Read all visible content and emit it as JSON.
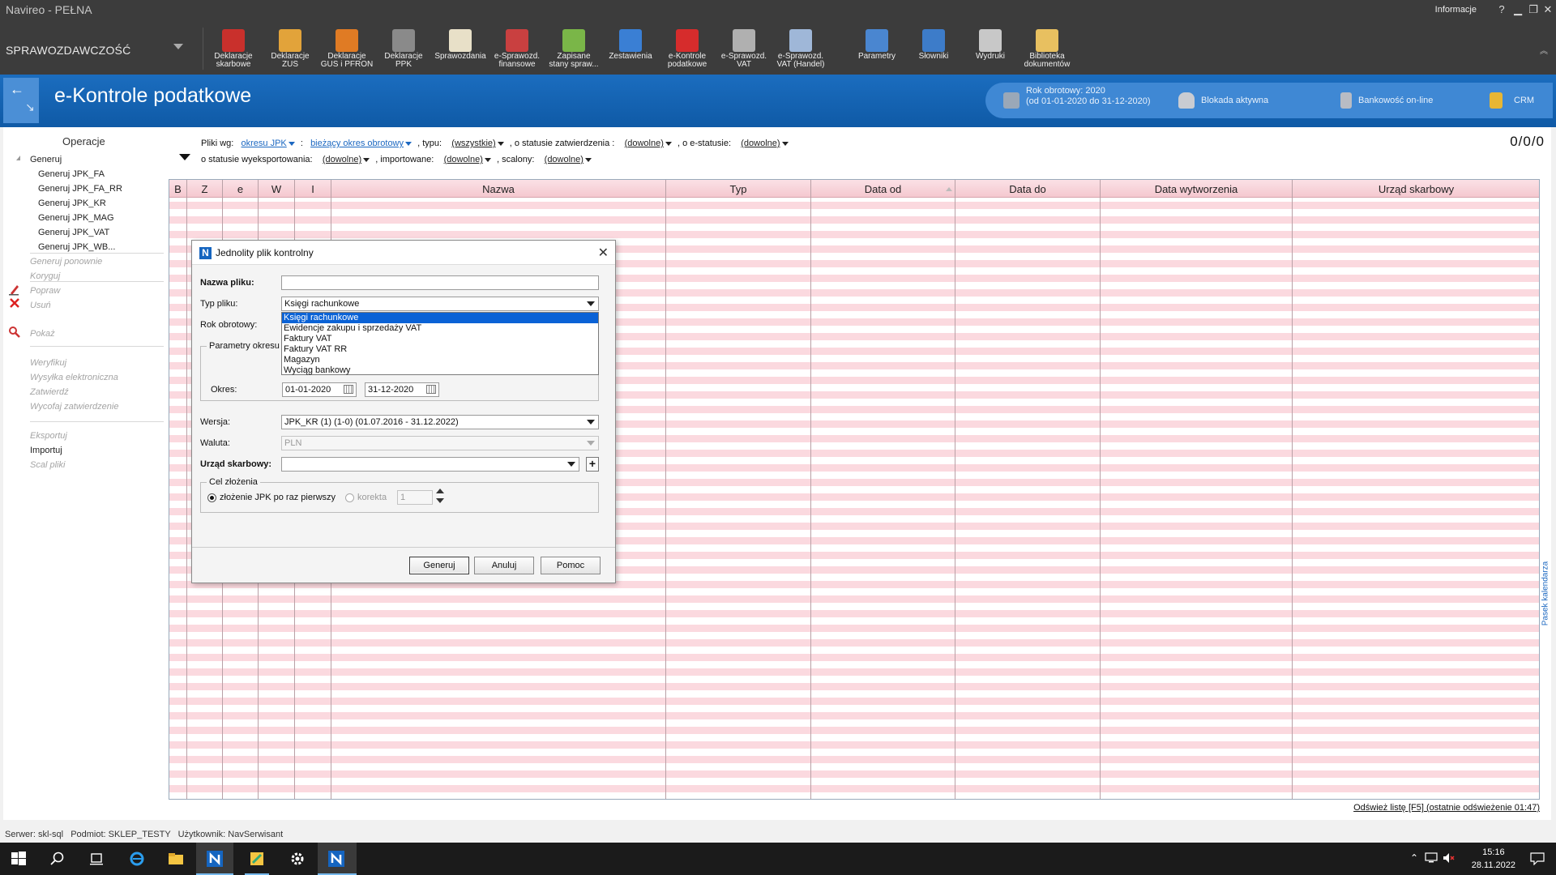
{
  "window": {
    "title": "Navireo - PEŁNA",
    "info_label": "Informacje",
    "help": "?",
    "minimize": "▁",
    "restore": "❐",
    "close": "✕"
  },
  "ribbon": {
    "module": "SPRAWOZDAWCZOŚĆ",
    "collapse": "︽",
    "tools": [
      {
        "line1": "Deklaracje",
        "line2": "skarbowe",
        "icon": "tax-declaration-icon",
        "color": "#c9302c"
      },
      {
        "line1": "Deklaracje",
        "line2": "ZUS",
        "icon": "zus-declaration-icon",
        "color": "#e2a33a"
      },
      {
        "line1": "Deklaracje",
        "line2": "GUS i PFRON",
        "icon": "gus-declaration-icon",
        "color": "#e07b24"
      },
      {
        "line1": "Deklaracje",
        "line2": "PPK",
        "icon": "ppk-declaration-icon",
        "color": "#8a8a8a"
      },
      {
        "line1": "Sprawozdania",
        "line2": "",
        "icon": "reports-icon",
        "color": "#e8e0c8"
      },
      {
        "line1": "e-Sprawozd.",
        "line2": "finansowe",
        "icon": "e-financial-report-icon",
        "color": "#c94040"
      },
      {
        "line1": "Zapisane",
        "line2": "stany spraw...",
        "icon": "saved-states-icon",
        "color": "#7ab648"
      },
      {
        "line1": "Zestawienia",
        "line2": "",
        "icon": "statements-chart-icon",
        "color": "#3a7fd4"
      },
      {
        "line1": "e-Kontrole",
        "line2": "podatkowe",
        "icon": "e-tax-control-icon",
        "color": "#d62c2c"
      },
      {
        "line1": "e-Sprawozd.",
        "line2": "VAT",
        "icon": "e-vat-report-icon",
        "color": "#b0b0b0"
      },
      {
        "line1": "e-Sprawozd.",
        "line2": "VAT (Handel)",
        "icon": "e-vat-trade-report-icon",
        "color": "#9fb7d8"
      },
      {
        "line1": "Parametry",
        "line2": "",
        "icon": "parameters-icon",
        "color": "#4a86d0"
      },
      {
        "line1": "Słowniki",
        "line2": "",
        "icon": "dictionaries-icon",
        "color": "#3d7cc9"
      },
      {
        "line1": "Wydruki",
        "line2": "",
        "icon": "printouts-icon",
        "color": "#c8c8c8"
      },
      {
        "line1": "Biblioteka",
        "line2": "dokumentów",
        "icon": "document-library-icon",
        "color": "#e8c060"
      }
    ]
  },
  "header": {
    "title": "e-Kontrole podatkowe",
    "year_line1": "Rok obrotowy: 2020",
    "year_line2": "(od 01-01-2020 do 31-12-2020)",
    "lock": "Blokada aktywna",
    "bank": "Bankowość on-line",
    "crm": "CRM"
  },
  "operations": {
    "title": "Operacje",
    "items": [
      {
        "label": "Generuj",
        "state": "act",
        "sub": false
      },
      {
        "label": "Generuj JPK_FA",
        "state": "act",
        "sub": true
      },
      {
        "label": "Generuj JPK_FA_RR",
        "state": "act",
        "sub": true
      },
      {
        "label": "Generuj JPK_KR",
        "state": "act",
        "sub": true
      },
      {
        "label": "Generuj JPK_MAG",
        "state": "act",
        "sub": true
      },
      {
        "label": "Generuj JPK_VAT",
        "state": "act",
        "sub": true
      },
      {
        "label": "Generuj JPK_WB...",
        "state": "act",
        "sub": true
      },
      {
        "label": "Generuj ponownie",
        "state": "dis",
        "sub": false
      },
      {
        "label": "Koryguj",
        "state": "dis",
        "sub": false
      },
      {
        "label": "Popraw",
        "state": "dis",
        "sub": false
      },
      {
        "label": "Usuń",
        "state": "dis",
        "sub": false
      },
      {
        "label": "Pokaż",
        "state": "dis",
        "sub": false
      },
      {
        "label": "Weryfikuj",
        "state": "dis",
        "sub": false
      },
      {
        "label": "Wysyłka elektroniczna",
        "state": "dis",
        "sub": false
      },
      {
        "label": "Zatwierdź",
        "state": "dis",
        "sub": false
      },
      {
        "label": "Wycofaj zatwierdzenie",
        "state": "dis",
        "sub": false
      },
      {
        "label": "Eksportuj",
        "state": "dis",
        "sub": false
      },
      {
        "label": "Importuj",
        "state": "act",
        "sub": false
      },
      {
        "label": "Scal pliki",
        "state": "dis",
        "sub": false
      }
    ]
  },
  "filters": {
    "row1": {
      "prefix": "Pliki wg:",
      "by": "okresu JPK",
      "colon": ":",
      "period": "bieżący okres obrotowy",
      "type_label": ", typu:",
      "type": "(wszystkie)",
      "approval_label": ", o statusie zatwierdzenia :",
      "approval": "(dowolne)",
      "estatus_label": ", o e-statusie:",
      "estatus": "(dowolne)"
    },
    "row2": {
      "export_label": "o statusie wyeksportowania:",
      "export": "(dowolne)",
      "imported_label": ", importowane:",
      "imported": "(dowolne)",
      "merged_label": ", scalony:",
      "merged": "(dowolne)"
    },
    "counter": "0/0/0"
  },
  "grid": {
    "columns": [
      "B",
      "Z",
      "e",
      "W",
      "I",
      "Nazwa",
      "Typ",
      "Data od",
      "Data do",
      "Data wytworzenia",
      "Urząd skarbowy"
    ]
  },
  "refresh_link": "Odśwież listę [F5] (ostatnie odświeżenie 01:47)",
  "calendar_strip": "Pasek kalendarza",
  "dialog": {
    "title": "Jednolity plik kontrolny",
    "logo": "N",
    "file_name_label": "Nazwa pliku:",
    "file_name_value": "",
    "file_type_label": "Typ pliku:",
    "file_type_value": "Księgi rachunkowe",
    "fiscal_year_label": "Rok obrotowy:",
    "period_group_label": "Parametry okresu",
    "file_type_options": [
      "Księgi rachunkowe",
      "Ewidencje zakupu i sprzedaży VAT",
      "Faktury VAT",
      "Faktury VAT RR",
      "Magazyn",
      "Wyciąg bankowy"
    ],
    "period_label": "Okres:",
    "date_from": "01-01-2020",
    "date_to": "31-12-2020",
    "version_label": "Wersja:",
    "version_value": "JPK_KR (1) (1-0) (01.07.2016 - 31.12.2022)",
    "currency_label": "Waluta:",
    "currency_value": "PLN",
    "tax_office_label": "Urząd skarbowy:",
    "tax_office_value": "",
    "purpose_group_label": "Cel złożenia",
    "purpose_first": "złożenie JPK po raz pierwszy",
    "purpose_correction": "korekta",
    "correction_number": "1",
    "btn_generate": "Generuj",
    "btn_cancel": "Anuluj",
    "btn_help": "Pomoc"
  },
  "statusbar": {
    "server": "Serwer: skl-sql",
    "entity": "Podmiot: SKLEP_TESTY",
    "user": "Użytkownik: NavSerwisant"
  },
  "taskbar": {
    "time": "15:16",
    "date": "28.11.2022"
  }
}
